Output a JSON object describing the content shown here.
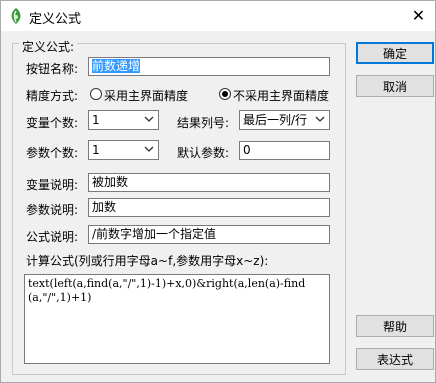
{
  "window": {
    "title": "定义公式"
  },
  "group": {
    "legend": "定义公式:"
  },
  "form": {
    "button_name_label": "按钮名称:",
    "button_name_value": "前数递增",
    "precision_label": "精度方式:",
    "precision_option1": "采用主界面精度",
    "precision_option2": "不采用主界面精度",
    "precision_selected": "不采用主界面精度",
    "var_count_label": "变量个数:",
    "var_count_value": "1",
    "result_col_label": "结果列号:",
    "result_col_value": "最后一列/行",
    "param_count_label": "参数个数:",
    "param_count_value": "1",
    "default_param_label": "默认参数:",
    "default_param_value": "0",
    "var_desc_label": "变量说明:",
    "var_desc_value": "被加数",
    "param_desc_label": "参数说明:",
    "param_desc_value": "加数",
    "formula_desc_label": "公式说明:",
    "formula_desc_value": "/前数字增加一个指定值",
    "calc_formula_label": "计算公式(列或行用字母a~f,参数用字母x~z):",
    "calc_formula_value": "text(left(a,find(a,\"/\",1)-1)+x,0)&right(a,len(a)-find(a,\"/\",1)+1)"
  },
  "buttons": {
    "ok": "确定",
    "cancel": "取消",
    "help": "帮助",
    "expression": "表达式"
  },
  "icons": {
    "app": "app-leaf-icon",
    "close": "close-icon",
    "dropdown": "chevron-down-icon"
  }
}
